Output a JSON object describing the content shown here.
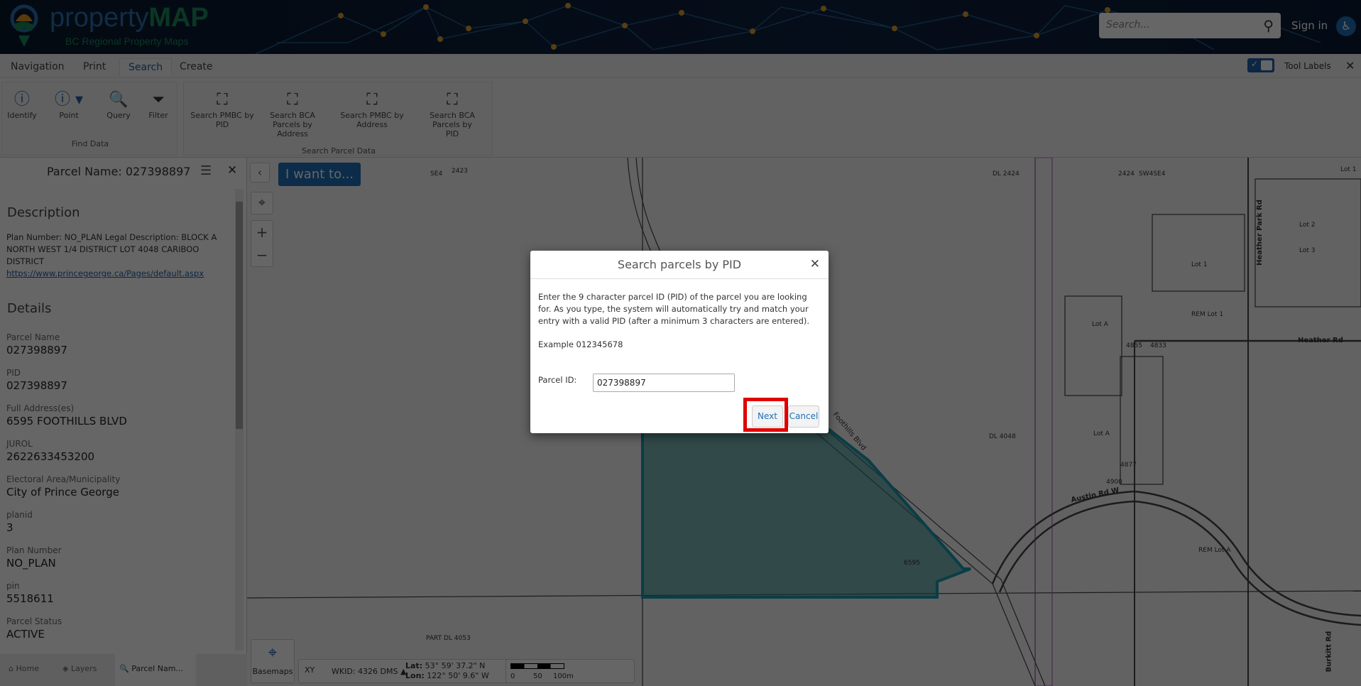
{
  "header": {
    "brand_prefix": "property",
    "brand_suffix": "MAP",
    "subtitle": "BC Regional Property Maps",
    "search_placeholder": "Search...",
    "sign_in": "Sign in"
  },
  "tabs": [
    {
      "label": "Navigation"
    },
    {
      "label": "Print"
    },
    {
      "label": "Search",
      "active": true
    },
    {
      "label": "Create"
    }
  ],
  "tool_labels": {
    "label": "Tool Labels",
    "checked": true
  },
  "ribbon": {
    "find_data": {
      "label": "Find Data",
      "buttons": [
        "Identify",
        "Point",
        "Query",
        "Filter"
      ]
    },
    "search_parcel_data": {
      "label": "Search Parcel Data",
      "buttons": [
        "Search PMBC by PID",
        "Search BCA Parcels by Address",
        "Search PMBC by Address",
        "Search BCA Parcels by PID"
      ]
    }
  },
  "panel": {
    "title": "Parcel Name: 027398897",
    "description_heading": "Description",
    "description": "Plan Number: NO_PLAN  Legal Description: BLOCK A NORTH WEST 1/4 DISTRICT LOT 4048 CARIBOO DISTRICT",
    "link": "https://www.princegeorge.ca/Pages/default.aspx",
    "details_heading": "Details",
    "fields": [
      {
        "label": "Parcel Name",
        "value": "027398897"
      },
      {
        "label": "PID",
        "value": "027398897"
      },
      {
        "label": "Full Address(es)",
        "value": "6595 FOOTHILLS BLVD"
      },
      {
        "label": "JUROL",
        "value": "2622633453200"
      },
      {
        "label": "Electoral Area/Municipality",
        "value": "City of Prince George"
      },
      {
        "label": "planid",
        "value": "3"
      },
      {
        "label": "Plan Number",
        "value": "NO_PLAN"
      },
      {
        "label": "pin",
        "value": "5518611"
      },
      {
        "label": "Parcel Status",
        "value": "ACTIVE"
      }
    ],
    "bottom_tabs": [
      "Home",
      "Layers",
      "Parcel Nam..."
    ]
  },
  "map": {
    "i_want_to": "I want to...",
    "basemaps": "Basemaps",
    "wkid": "WKID: 4326 DMS ▲",
    "lat_label": "Lat:",
    "lat": "53° 59' 37.2\" N",
    "lon_label": "Lon:",
    "lon": "122° 50' 9.6\" W",
    "scale": [
      "0",
      "50",
      "100m"
    ],
    "labels": [
      "SE4",
      "2423",
      "DL 2424",
      "2424",
      "SW4SE4",
      "Lot 1",
      "Lot 2",
      "Lot 3",
      "Lot 1",
      "REM Lot 1",
      "Lot A",
      "Heather Rd",
      "Heather Park Rd",
      "Foothills Blvd",
      "DL 4048",
      "Austin Rd W",
      "REM Lot A",
      "PART DL 4053",
      "6595",
      "4900",
      "4877",
      "4855",
      "4833",
      "Burkitt Rd",
      "Lot A"
    ],
    "parcel_color": "#2a8c8c"
  },
  "dialog": {
    "title": "Search parcels by PID",
    "instructions": "Enter the 9 character parcel ID (PID) of the parcel you are looking for. As you type, the system will automatically try and match your entry with a valid PID (after a minimum 3 characters are entered).",
    "example": "Example 012345678",
    "field_label": "Parcel ID:",
    "field_value": "027398897",
    "next": "Next",
    "cancel": "Cancel",
    "highlight_color": "#e00000"
  }
}
